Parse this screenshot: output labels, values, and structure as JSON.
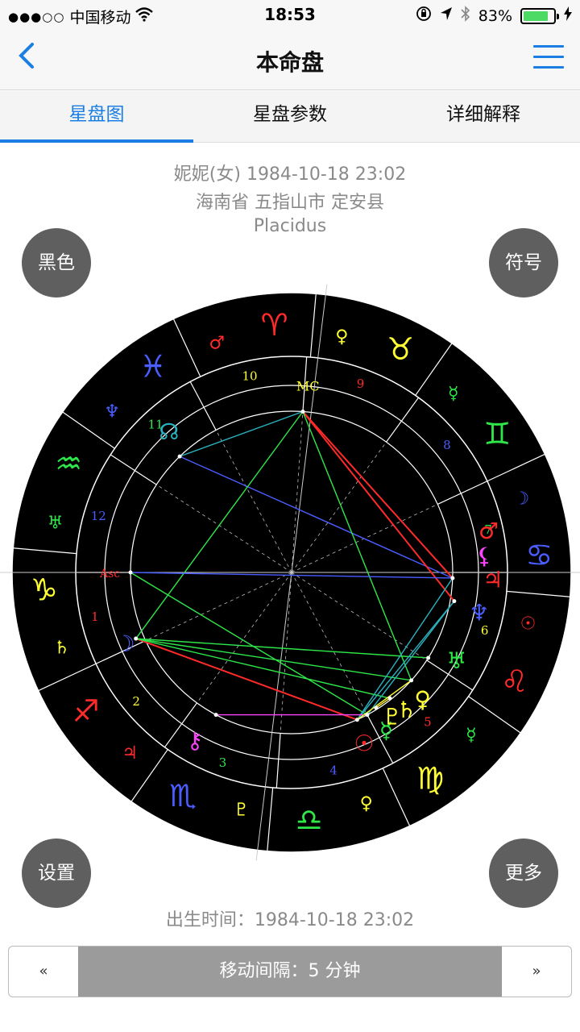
{
  "status": {
    "carrier": "中国移动",
    "time": "18:53",
    "battery": "83%",
    "battery_level": 0.83
  },
  "nav": {
    "title": "本命盘"
  },
  "tabs": [
    {
      "label": "星盘图"
    },
    {
      "label": "星盘参数"
    },
    {
      "label": "详细解释"
    }
  ],
  "info": {
    "line1": "妮妮(女) 1984-10-18 23:02",
    "line2": "海南省 五指山市 定安县",
    "line3": "Placidus"
  },
  "buttons": {
    "black": "黑色",
    "symbol": "符号",
    "settings": "设置",
    "more": "更多"
  },
  "birth_time": "出生时间：1984-10-18 23:02",
  "stepper": {
    "prev": "«",
    "label": "移动间隔：5 分钟",
    "next": "»"
  },
  "chart": {
    "house_numbers": [
      "1",
      "2",
      "3",
      "4",
      "5",
      "6",
      "7",
      "8",
      "9",
      "10",
      "11",
      "12"
    ],
    "zodiac_signs": [
      {
        "glyph": "♈",
        "color": "#ff2a2a",
        "ruler": "♂",
        "ruler_color": "#ff2a2a"
      },
      {
        "glyph": "♓",
        "color": "#4a5dff",
        "ruler": "♆",
        "ruler_color": "#4a5dff"
      },
      {
        "glyph": "♒",
        "color": "#2ee84a",
        "ruler": "♅",
        "ruler_color": "#2ee84a"
      },
      {
        "glyph": "♑",
        "color": "#ffff33",
        "ruler": "♄",
        "ruler_color": "#ffff33"
      },
      {
        "glyph": "♐",
        "color": "#ff2a2a",
        "ruler": "♃",
        "ruler_color": "#ff2a2a"
      },
      {
        "glyph": "♏",
        "color": "#4a5dff",
        "ruler": "♇",
        "ruler_color": "#ffff33"
      },
      {
        "glyph": "♎",
        "color": "#2ee84a",
        "ruler": "♀",
        "ruler_color": "#ffff33"
      },
      {
        "glyph": "♍",
        "color": "#ffff33",
        "ruler": "☿",
        "ruler_color": "#2ee84a"
      },
      {
        "glyph": "♌",
        "color": "#ff2a2a",
        "ruler": "☉",
        "ruler_color": "#ff2a2a"
      },
      {
        "glyph": "♋",
        "color": "#4a5dff",
        "ruler": "☽",
        "ruler_color": "#4a5dff"
      },
      {
        "glyph": "♊",
        "color": "#2ee84a",
        "ruler": "☿",
        "ruler_color": "#2ee84a"
      },
      {
        "glyph": "♉",
        "color": "#ffff33",
        "ruler": "♀",
        "ruler_color": "#ffff33"
      }
    ],
    "planets": [
      {
        "name": "sun",
        "glyph": "☉",
        "color": "#ff2a2a"
      },
      {
        "name": "moon",
        "glyph": "☽",
        "color": "#4a5dff"
      },
      {
        "name": "mercury",
        "glyph": "☿",
        "color": "#2ee84a"
      },
      {
        "name": "venus",
        "glyph": "♀",
        "color": "#ffff33"
      },
      {
        "name": "mars",
        "glyph": "♂",
        "color": "#ff2a2a"
      },
      {
        "name": "jupiter",
        "glyph": "♃",
        "color": "#ff2a2a"
      },
      {
        "name": "saturn",
        "glyph": "♄",
        "color": "#ffff33"
      },
      {
        "name": "uranus",
        "glyph": "♅",
        "color": "#2ee84a"
      },
      {
        "name": "neptune",
        "glyph": "♆",
        "color": "#4a5dff"
      },
      {
        "name": "pluto",
        "glyph": "♇",
        "color": "#ffff33"
      },
      {
        "name": "node",
        "glyph": "☊",
        "color": "#2ab3c0"
      },
      {
        "name": "chiron",
        "glyph": "⚷",
        "color": "#ff44ff"
      },
      {
        "name": "lilith",
        "glyph": "⚸",
        "color": "#ff44ff"
      }
    ],
    "asc_label": "Asc",
    "mc_label": "MC"
  }
}
